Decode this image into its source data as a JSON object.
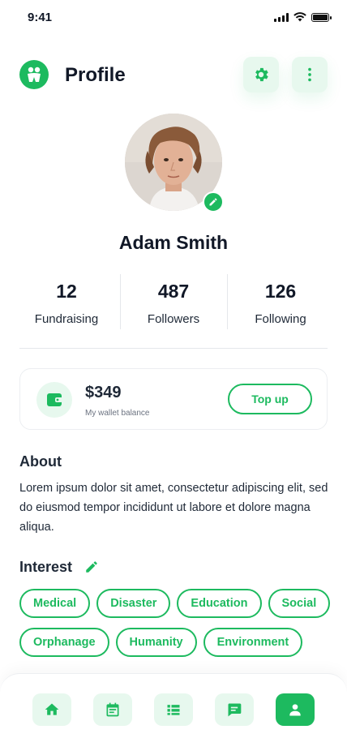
{
  "status_bar": {
    "time": "9:41"
  },
  "header": {
    "title": "Profile"
  },
  "profile": {
    "name": "Adam Smith"
  },
  "stats": [
    {
      "value": "12",
      "label": "Fundraising"
    },
    {
      "value": "487",
      "label": "Followers"
    },
    {
      "value": "126",
      "label": "Following"
    }
  ],
  "wallet": {
    "amount": "$349",
    "caption": "My wallet balance",
    "topup_label": "Top up"
  },
  "about": {
    "title": "About",
    "text": "Lorem ipsum dolor sit amet, consectetur adipiscing elit, sed do eiusmod tempor incididunt ut labore et dolore magna aliqua."
  },
  "interest": {
    "title": "Interest",
    "chips": [
      "Medical",
      "Disaster",
      "Education",
      "Social",
      "Orphanage",
      "Humanity",
      "Environment"
    ]
  },
  "nav": {
    "items": [
      "home-icon",
      "calendar-icon",
      "list-icon",
      "message-icon",
      "profile-icon"
    ],
    "active": "profile-icon"
  },
  "colors": {
    "accent": "#1dba5f",
    "accent_light": "#e7f8ee",
    "text": "#1f2937"
  }
}
